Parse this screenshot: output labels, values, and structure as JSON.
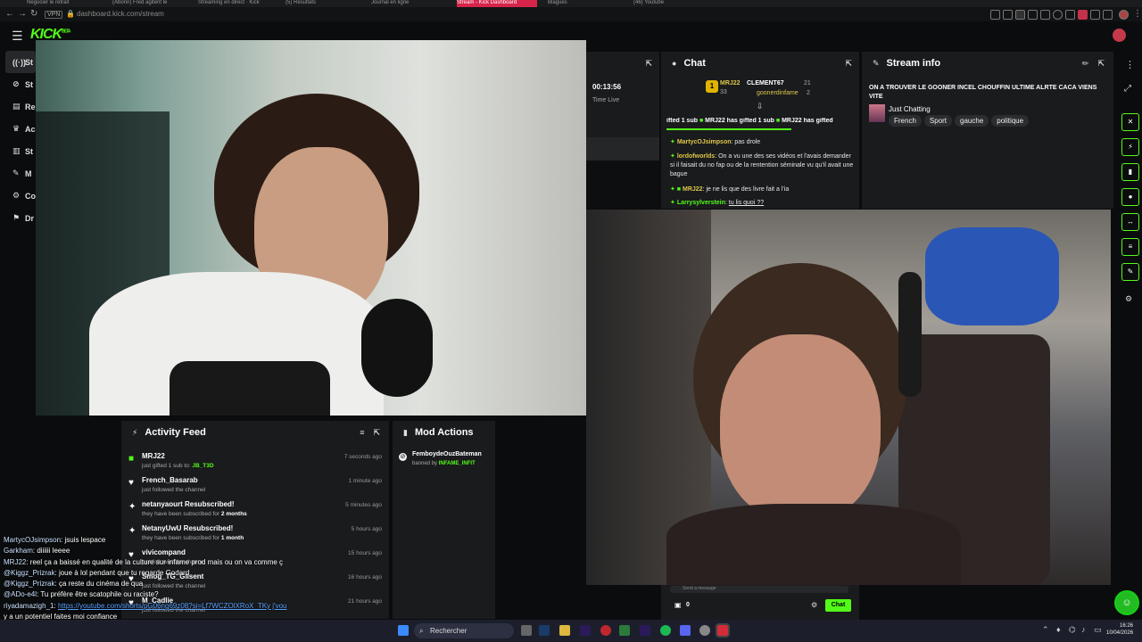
{
  "browser": {
    "tabs": [
      "Négocier le retrait",
      "(Abonn) Fred agitent le",
      "Streaming en direct · Kick",
      "(5) Résultats",
      "Journal en ligne",
      "Stream - Kick Dashboard",
      "Blagues",
      "(46) Youtube"
    ],
    "url": "dashboard.kick.com/stream"
  },
  "kick": {
    "logo": "KICK",
    "beta": "BETA"
  },
  "leftnav": [
    {
      "icon": "stream-icon",
      "label": "St"
    },
    {
      "icon": "link-icon",
      "label": "St"
    },
    {
      "icon": "replay-icon",
      "label": "Re"
    },
    {
      "icon": "trophy-icon",
      "label": "Ac"
    },
    {
      "icon": "stats-icon",
      "label": "St"
    },
    {
      "icon": "wrench-icon",
      "label": "M"
    },
    {
      "icon": "gear-icon",
      "label": "Co"
    },
    {
      "icon": "drops-icon",
      "label": "Dr"
    }
  ],
  "session": {
    "timer": "00:13:56",
    "timer_label": "Time Live"
  },
  "chat": {
    "title": "Chat",
    "top_users": [
      {
        "name": "MRJ22",
        "count": "33"
      },
      {
        "name": "CLEMENT67",
        "count": "21"
      },
      {
        "name": "goonerdinfame",
        "count": "2"
      }
    ],
    "gift_ticker": [
      "ifted 1 sub",
      "MRJ22 has gifted 1 sub",
      "MRJ22 has gifted"
    ],
    "messages": [
      {
        "user": "MartycOJsimpson",
        "text": "pas drole"
      },
      {
        "user": "lordofworlds",
        "text": "On a vu une des ses vidéos et l'avais demander si il faisait du no fap ou de la rentention séminale vu qu'il avait une bague"
      },
      {
        "user": "MRJ22",
        "text": "je ne lis que des livre fait a l'ia"
      },
      {
        "user": "Larrysylverstein",
        "text": "tu lis quoi ??"
      }
    ],
    "input_placeholder": "Send a message",
    "points": "0",
    "send": "Chat"
  },
  "stream_info": {
    "title_label": "Stream info",
    "title": "ON A TROUVER LE GOONER INCEL CHOUFFIN ULTIME ALRTE CACA VIENS VITE",
    "category": "Just Chatting",
    "tags": [
      "French",
      "Sport",
      "gauche",
      "politique"
    ]
  },
  "activity": {
    "title": "Activity Feed",
    "items": [
      {
        "icon": "gift-icon",
        "name": "MRJ22",
        "sub": "just gifted 1 sub to:",
        "highlight": "JB_T3D",
        "time": "7 seconds ago"
      },
      {
        "icon": "heart-icon",
        "name": "French_Basarab",
        "sub": "just followed the channel",
        "highlight": "",
        "time": "1 minute ago"
      },
      {
        "icon": "star-icon",
        "name": "netanyaourt Resubscribed!",
        "sub": "they have been subscribed for",
        "highlight": "2 months",
        "time": "5 minutes ago"
      },
      {
        "icon": "star-icon",
        "name": "NetanyUwU Resubscribed!",
        "sub": "they have been subscribed for",
        "highlight": "1 month",
        "time": "5 hours ago"
      },
      {
        "icon": "heart-icon",
        "name": "vivicompand",
        "sub": "just followed the channel",
        "highlight": "",
        "time": "15 hours ago"
      },
      {
        "icon": "heart-icon",
        "name": "Smog_TG_Glisent",
        "sub": "just followed the channel",
        "highlight": "",
        "time": "16 hours ago"
      },
      {
        "icon": "heart-icon",
        "name": "M_Cadlie",
        "sub": "just followed the channel",
        "highlight": "",
        "time": "21 hours ago"
      }
    ]
  },
  "mod_actions": {
    "title": "Mod Actions",
    "items": [
      {
        "user": "FemboydeOuzBateman",
        "action": "banned by",
        "by": "INFAME_INFIT"
      }
    ]
  },
  "overlay_chat": [
    {
      "user": "MartycOJsimpson",
      "text": "jsuis lespace"
    },
    {
      "user": "Garkham",
      "text": "diiiiii leeee"
    },
    {
      "user": "MRJ22",
      "text": "reel ça a baissé en qualité de la culture sur infame prod mais ou on va comme ç"
    },
    {
      "user": "@Kiggz_Prizrak",
      "text": "joue à lol pendant que tu regarde Godard"
    },
    {
      "user": "@Kiggz_Prizrak",
      "text": "ça reste du cinéma de qua"
    },
    {
      "user": "@ADo-e4l",
      "text": "Tu préfère être scatophile ou raciste?"
    },
    {
      "user": "riyadamazigh_1",
      "text": "https://youtube.com/shorts/pG06ng69z08?si=Lf7WCZOlXRoX_TKy j'vou"
    },
    {
      "user": "",
      "text": "y a un potentiel faites moi confiance"
    }
  ],
  "taskbar": {
    "search": "Rechercher",
    "time": "16:26",
    "date": "10/04/2026"
  }
}
